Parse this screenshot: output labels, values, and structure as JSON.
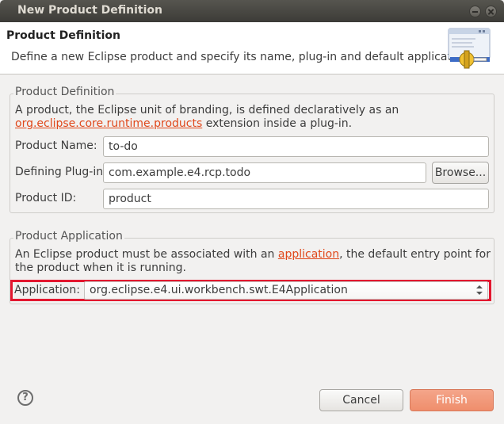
{
  "window": {
    "title": "New Product Definition"
  },
  "header": {
    "title": "Product Definition",
    "description": "Define a new Eclipse product and specify its name, plug-in and default application."
  },
  "definition_group": {
    "legend": "Product Definition",
    "line1": "A product, the Eclipse unit of branding, is defined declaratively as an",
    "link": "org.eclipse.core.runtime.products",
    "line2_suffix": " extension inside a plug-in.",
    "product_name_label": "Product Name:",
    "product_name_value": "to-do",
    "plugin_label": "Defining Plug-in:",
    "plugin_value": "com.example.e4.rcp.todo",
    "browse_label": "Browse...",
    "product_id_label": "Product ID:",
    "product_id_value": "product"
  },
  "application_group": {
    "legend": "Product Application",
    "line1_prefix": "An Eclipse product must be associated with an ",
    "line1_link": "application",
    "line1_suffix": ", the default entry point for",
    "line2": "the product when it is running.",
    "application_label": "Application:",
    "application_value": "org.eclipse.e4.ui.workbench.swt.E4Application"
  },
  "footer": {
    "help_label": "?",
    "cancel_label": "Cancel",
    "finish_label": "Finish"
  },
  "colors": {
    "accent": "#ef8e6c",
    "link": "#e0481b",
    "highlight": "#e3172f"
  }
}
